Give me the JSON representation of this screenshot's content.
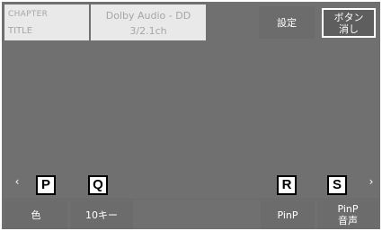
{
  "info": {
    "chapter_label": "CHAPTER",
    "title_label": "TITLE",
    "audio_format": "Dolby Audio - DD",
    "audio_channels": "3/2.1ch"
  },
  "top_buttons": {
    "settings_label": "設定",
    "hide_line1": "ボタン",
    "hide_line2": "消し"
  },
  "nav": {
    "left_arrow": "‹",
    "right_arrow": "›"
  },
  "bottom_buttons": {
    "color_label": "色",
    "tenkey_label": "10キー",
    "pinp_label": "PinP",
    "pinp_audio_line1": "PinP",
    "pinp_audio_line2": "音声"
  },
  "callouts": {
    "p": "P",
    "q": "Q",
    "r": "R",
    "s": "S"
  },
  "colors": {
    "panel": "#707070",
    "button": "#6c6c6c",
    "info_box": "#e9e9e9",
    "text": "#ffffff"
  }
}
